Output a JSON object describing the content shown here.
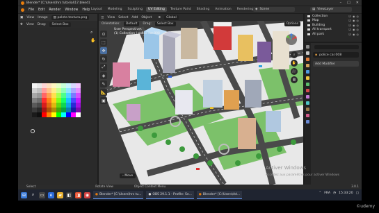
{
  "window": {
    "title": "Blender* [C:\\Users\\hrs tutorial\\17.blend]",
    "controls": [
      "–",
      "□",
      "✕"
    ]
  },
  "menubar": {
    "items": [
      "File",
      "Edit",
      "Render",
      "Window",
      "Help"
    ],
    "workspace_tabs": [
      "Layout",
      "Modeling",
      "Sculpting",
      "UV Editing",
      "Texture Paint",
      "Shading",
      "Animation",
      "Rendering",
      "Compositing"
    ],
    "active_tab": "UV Editing",
    "scene": "Scene",
    "view_layer": "ViewLayer"
  },
  "image_editor": {
    "header": [
      "View",
      "Image"
    ],
    "image_name": "paleta textura.png",
    "mode_label": "View",
    "drag_label": "Drag:",
    "select_box": "Select Box",
    "palette_colors": [
      "#f4f4f4",
      "#e9e9e9",
      "#ffd6d6",
      "#ffe0c0",
      "#fff6c0",
      "#e6ffc8",
      "#c8ffd8",
      "#c8f4ff",
      "#d8d8ff",
      "#f4c8ff",
      "#cfcfcf",
      "#bfbfbf",
      "#ff9d9d",
      "#ffc38a",
      "#ffec8a",
      "#c9ff8f",
      "#8fffb4",
      "#8fe6ff",
      "#a9a9ff",
      "#e68fff",
      "#a8a8a8",
      "#989898",
      "#ff6666",
      "#ffa04d",
      "#ffe04d",
      "#a6ff4d",
      "#4dff8a",
      "#4dd6ff",
      "#7a7aff",
      "#d64dff",
      "#808080",
      "#707070",
      "#ff2e2e",
      "#ff7f1a",
      "#ffd21a",
      "#7fff1a",
      "#1aff66",
      "#1ac4ff",
      "#4a4aff",
      "#c41aff",
      "#5a5a5a",
      "#4a4a4a",
      "#d81e1e",
      "#e06a10",
      "#e0b810",
      "#5fd610",
      "#10d650",
      "#10a4e0",
      "#2a2ad6",
      "#a410e0",
      "#3a3a3a",
      "#2a2a2a",
      "#a81414",
      "#b05208",
      "#b08c08",
      "#44a808",
      "#08a83c",
      "#0880b0",
      "#1a1aa8",
      "#8008b0",
      "#1a1a1a",
      "#101010",
      "#ff0000",
      "#ff8000",
      "#ffff00",
      "#00ff00",
      "#00ffff",
      "#0000ff",
      "#ff00ff",
      "#ffffff"
    ]
  },
  "viewport": {
    "header": [
      "View",
      "Select",
      "Add",
      "Object"
    ],
    "orientation_label": "Orientation:",
    "orientation_value": "Default",
    "drag_label": "Drag:",
    "select_box": "Select Box",
    "transform": "Global",
    "options": "Options",
    "overlay_lines": [
      "User Perspective",
      "(1) Collection | police car.008"
    ],
    "move_label": "Move",
    "tools": [
      "cursor",
      "select",
      "move",
      "rotate",
      "scale",
      "transform",
      "annotate",
      "measure",
      "add-cube"
    ],
    "watermark_title": "Activer Windows",
    "watermark_sub": "Accédez aux paramètres pour activer Windows"
  },
  "outliner": {
    "rows": [
      {
        "name": "Collection"
      },
      {
        "name": "Map"
      },
      {
        "name": "Building"
      },
      {
        "name": "All transport"
      },
      {
        "name": "All park"
      }
    ]
  },
  "properties": {
    "object_name": "police car.008",
    "add_modifier": "Add Modifier",
    "tab_colors": [
      "#8a8a8a",
      "#c9c9c9",
      "#e07b3a",
      "#d4a35a",
      "#4f9de0",
      "#f0c640",
      "#5bbd6b",
      "#d44b4b",
      "#c47bd4",
      "#4fc4c4",
      "#9a7a4a",
      "#d45a8a",
      "#6a8ad4"
    ]
  },
  "statusbar": {
    "left": "Select",
    "middle1": "Rotate View",
    "middle2": "Object Context Menu",
    "version": "3.0.1"
  },
  "taskbar": {
    "apps": [
      {
        "label": "Blender* [C:\\Users\\hrs tu..."
      },
      {
        "label": "OBS 29.1.1 - Profile: Se..."
      },
      {
        "label": "Blender* [C:\\Users\\Ad..."
      }
    ],
    "lang": "FRA",
    "time": "15:33:20"
  },
  "brand": {
    "accent": "#e87d0d",
    "selection_blue": "#4a6fa0",
    "udemy_label": "©udemy"
  }
}
